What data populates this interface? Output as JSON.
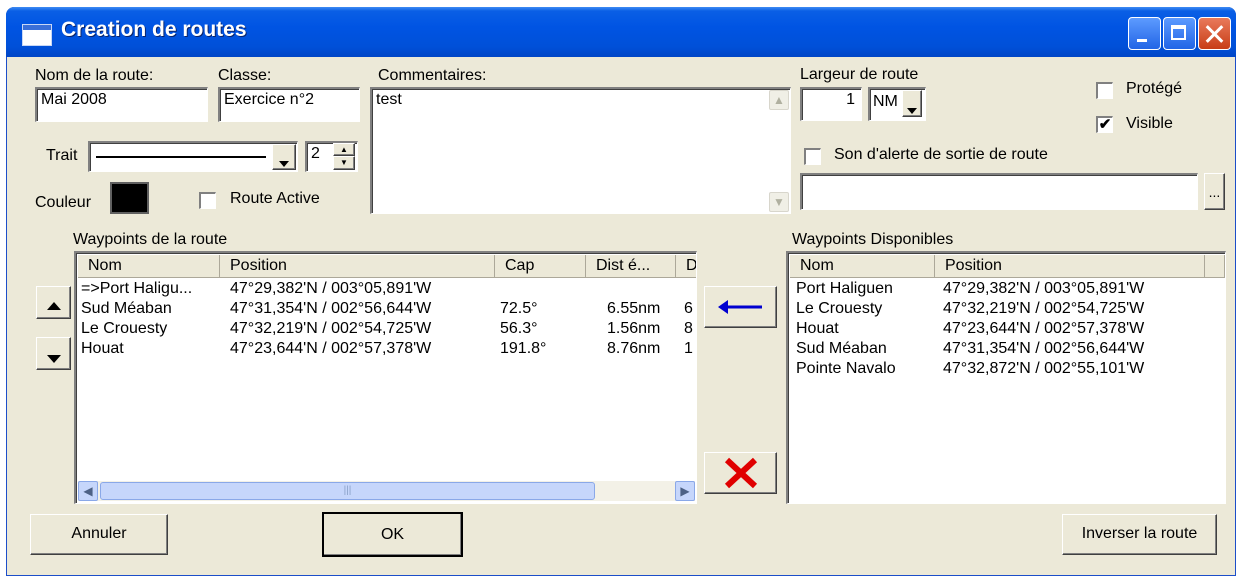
{
  "window": {
    "title": "Creation de routes"
  },
  "route_name": {
    "label": "Nom de la route:",
    "value": "Mai 2008"
  },
  "classe": {
    "label": "Classe:",
    "value": "Exercice n°2"
  },
  "commentaires": {
    "label": "Commentaires:",
    "value": "test"
  },
  "trait": {
    "label": "Trait",
    "width_value": "2"
  },
  "couleur": {
    "label": "Couleur",
    "color": "#000000"
  },
  "route_active": {
    "label": "Route Active",
    "checked": false
  },
  "largeur": {
    "label": "Largeur de route",
    "value": "1",
    "unit": "NM"
  },
  "protege": {
    "label": "Protégé",
    "checked": false,
    "mark": ""
  },
  "visible": {
    "label": "Visible",
    "checked": true,
    "mark": "✔"
  },
  "son_alerte": {
    "label": "Son d'alerte de sortie de route",
    "checked": false,
    "file_value": "",
    "browse_label": "..."
  },
  "route_waypoints": {
    "label": "Waypoints de la route",
    "columns": [
      "Nom",
      "Position",
      "Cap",
      "Dist é...",
      "D"
    ],
    "rows": [
      {
        "nom": "=>Port Haligu...",
        "position": "47°29,382'N / 003°05,891'W",
        "cap": "",
        "dist": "",
        "d": ""
      },
      {
        "nom": "Sud Méaban",
        "position": "47°31,354'N / 002°56,644'W",
        "cap": "72.5°",
        "dist": "6.55nm",
        "d": "6"
      },
      {
        "nom": "Le Crouesty",
        "position": "47°32,219'N / 002°54,725'W",
        "cap": "56.3°",
        "dist": "1.56nm",
        "d": "8"
      },
      {
        "nom": "Houat",
        "position": "47°23,644'N / 002°57,378'W",
        "cap": "191.8°",
        "dist": "8.76nm",
        "d": "1"
      }
    ]
  },
  "available_waypoints": {
    "label": "Waypoints Disponibles",
    "columns": [
      "Nom",
      "Position"
    ],
    "rows": [
      {
        "nom": "Port Haliguen",
        "position": "47°29,382'N / 003°05,891'W"
      },
      {
        "nom": "Le Crouesty",
        "position": "47°32,219'N / 002°54,725'W"
      },
      {
        "nom": "Houat",
        "position": "47°23,644'N / 002°57,378'W"
      },
      {
        "nom": "Sud Méaban",
        "position": "47°31,354'N / 002°56,644'W"
      },
      {
        "nom": "Pointe Navalo",
        "position": "47°32,872'N / 002°55,101'W"
      }
    ]
  },
  "buttons": {
    "annuler": "Annuler",
    "ok": "OK",
    "inverser": "Inverser la route"
  },
  "colors": {
    "titlebar": "#0054e3",
    "dialog_bg": "#ece9d8",
    "add_arrow": "#0000d0",
    "delete_x": "#e00000"
  }
}
